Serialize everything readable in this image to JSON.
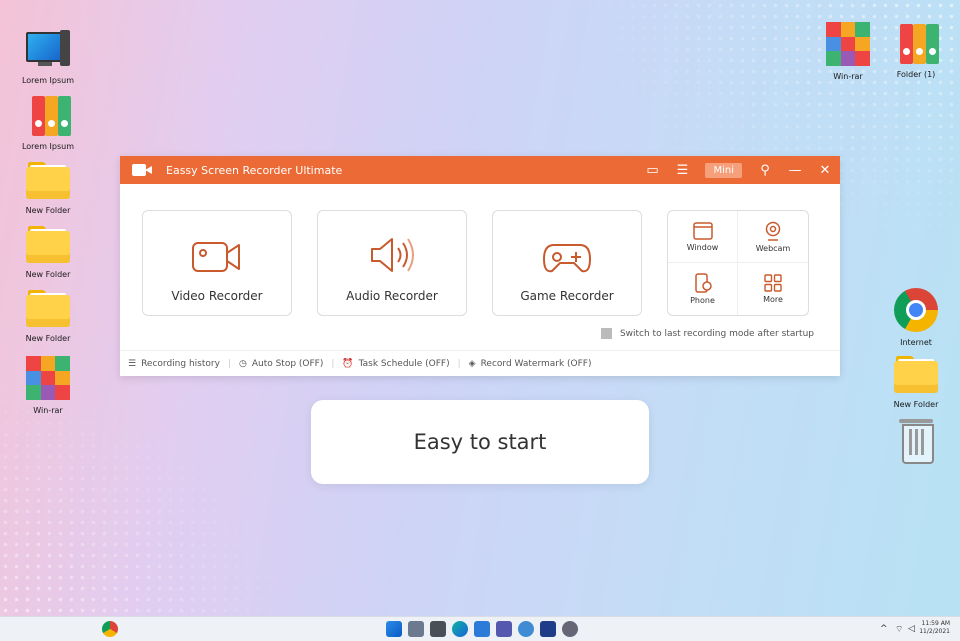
{
  "desktop": {
    "icons_left": [
      {
        "label": "Lorem Ipsum",
        "type": "computer"
      },
      {
        "label": "Lorem Ipsum",
        "type": "binders"
      },
      {
        "label": "New Folder",
        "type": "folder"
      },
      {
        "label": "New Folder",
        "type": "folder"
      },
      {
        "label": "New Folder",
        "type": "folder"
      },
      {
        "label": "Win-rar",
        "type": "rar"
      }
    ],
    "icons_top_right": [
      {
        "label": "Win-rar",
        "type": "rar"
      },
      {
        "label": "Folder (1)",
        "type": "binders"
      }
    ],
    "icons_right": [
      {
        "label": "Internet",
        "type": "chrome"
      },
      {
        "label": "New Folder",
        "type": "folder"
      },
      {
        "label": "",
        "type": "recycle-bin"
      }
    ]
  },
  "app": {
    "title": "Eassy Screen Recorder Ultimate",
    "accent": "#ec6a35",
    "mini_label": "Mini",
    "cards": [
      {
        "label": "Video Recorder",
        "icon": "video-camera-icon"
      },
      {
        "label": "Audio Recorder",
        "icon": "speaker-icon"
      },
      {
        "label": "Game Recorder",
        "icon": "gamepad-icon"
      }
    ],
    "quick": [
      {
        "label": "Window",
        "icon": "window-icon"
      },
      {
        "label": "Webcam",
        "icon": "webcam-icon"
      },
      {
        "label": "Phone",
        "icon": "phone-icon"
      },
      {
        "label": "More",
        "icon": "grid-icon"
      }
    ],
    "switch_label": "Switch to last recording mode after startup",
    "bottom": {
      "history": "Recording history",
      "auto_stop": "Auto Stop (OFF)",
      "task_schedule": "Task Schedule (OFF)",
      "watermark": "Record Watermark (OFF)"
    }
  },
  "banner": {
    "text": "Easy to start"
  },
  "taskbar": {
    "time": "11:59 AM",
    "date": "11/2/2021"
  }
}
